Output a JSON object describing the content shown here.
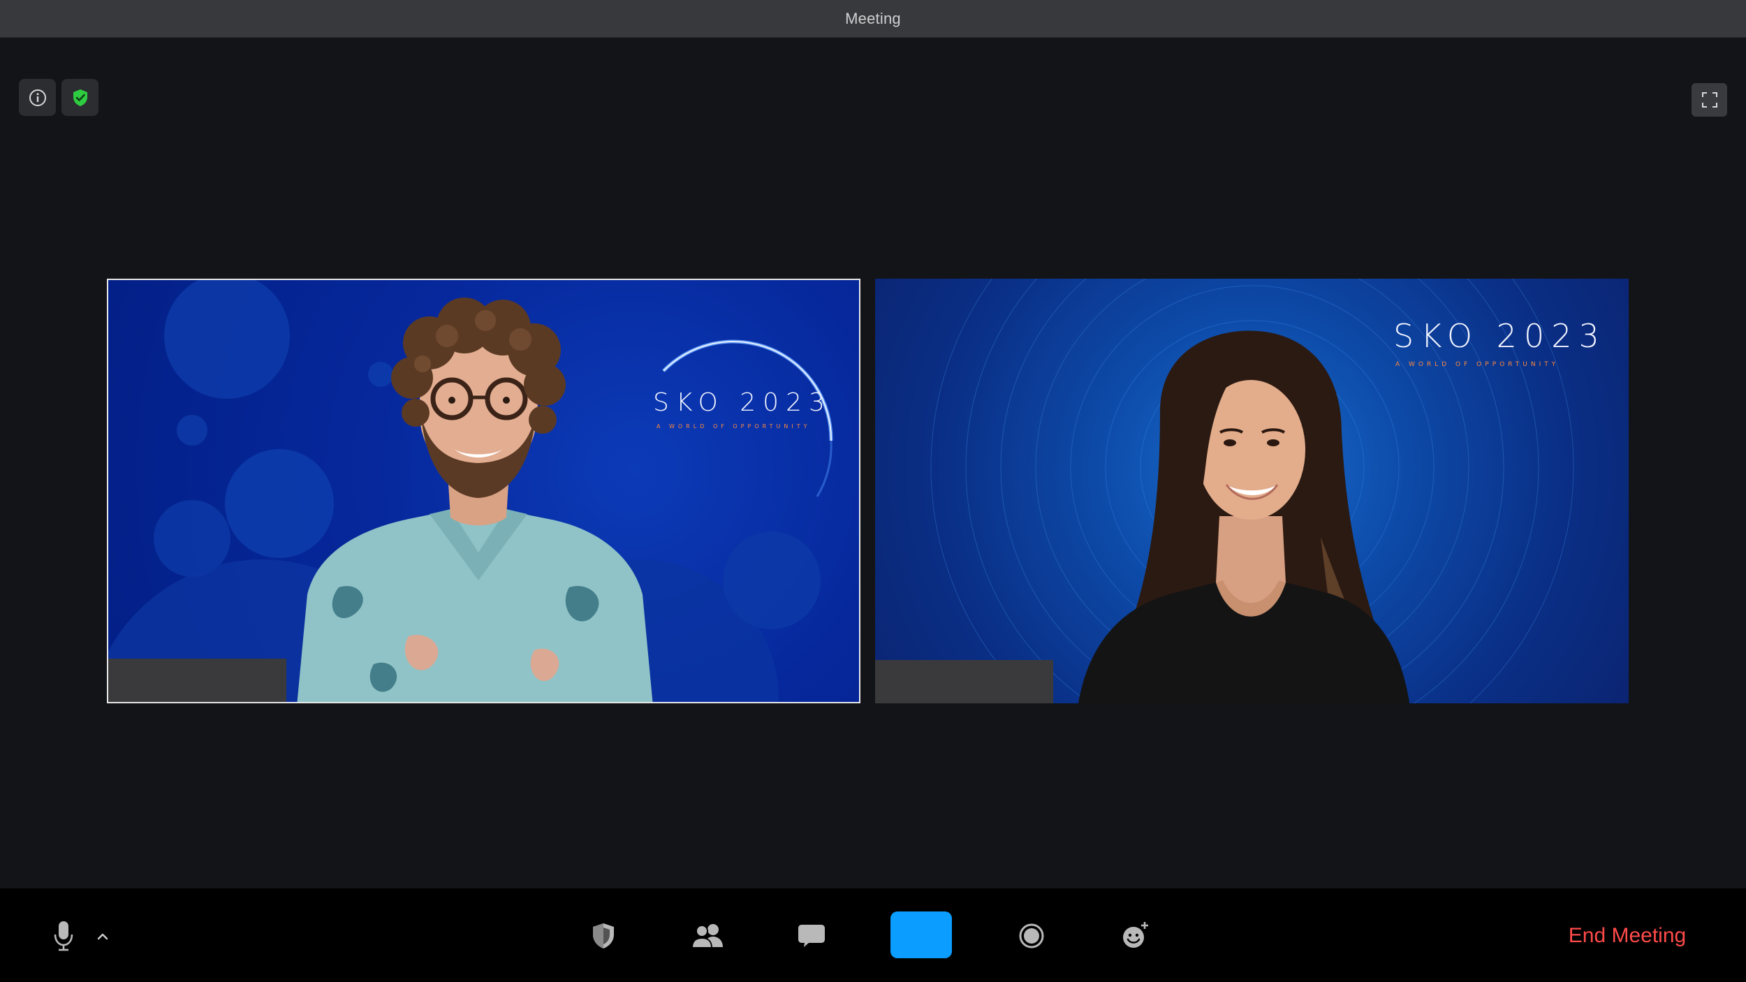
{
  "window": {
    "title": "Meeting"
  },
  "overlay": {
    "info_icon": "info-circle-icon",
    "security_badge_icon": "green-shield-check-icon",
    "security_color": "#2ecc40",
    "fullscreen_icon": "fullscreen-icon"
  },
  "participants": [
    {
      "tile": "left",
      "active_speaker": true,
      "background": {
        "title": "SKO 2023",
        "subtitle": "A WORLD OF OPPORTUNITY",
        "subtitle_color": "#ff8a3d"
      }
    },
    {
      "tile": "right",
      "active_speaker": false,
      "background": {
        "title": "SKO 2023",
        "subtitle": "A WORLD OF OPPORTUNITY",
        "subtitle_color": "#ff8a3d"
      }
    }
  ],
  "toolbar": {
    "mic_icon": "microphone-icon",
    "mic_options_icon": "chevron-up-icon",
    "security_icon": "shield-icon",
    "participants_icon": "participants-icon",
    "chat_icon": "chat-bubble-icon",
    "share_color": "#0b9dff",
    "record_icon": "record-icon",
    "reactions_icon": "emoji-plus-icon",
    "end_meeting_label": "End Meeting",
    "end_meeting_color": "#ff4a4a"
  }
}
